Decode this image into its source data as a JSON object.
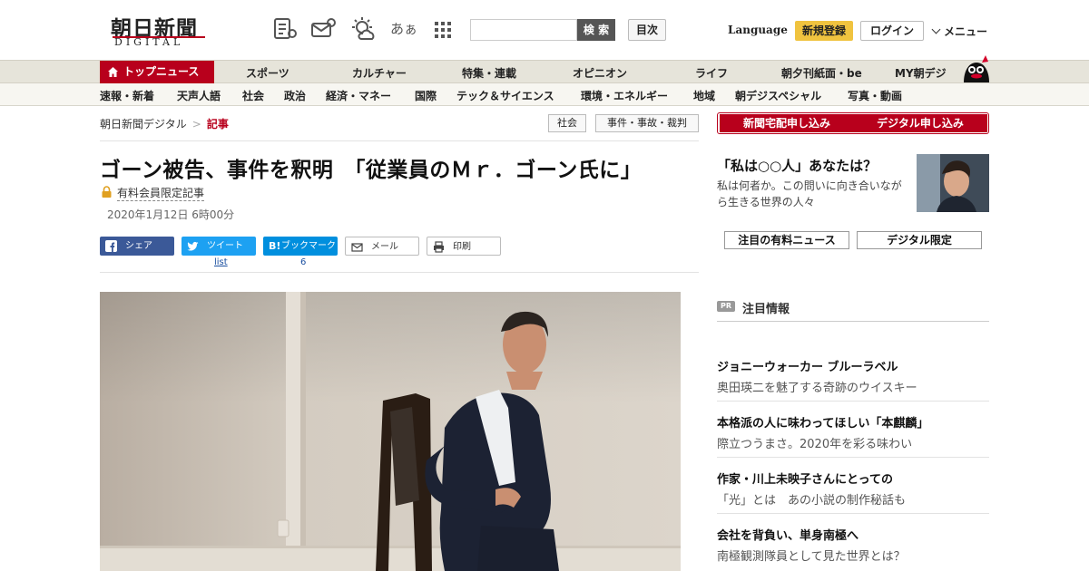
{
  "header": {
    "logo_main": "朝日新聞",
    "logo_sub": "DIGITAL",
    "icons": [
      "news-list-icon",
      "mail-icon",
      "weather-icon",
      "font-size-icon",
      "grid-menu-icon"
    ],
    "font_size_label": "あぁ",
    "search_placeholder": "",
    "search_button": "検 索",
    "toc_button": "目次",
    "language": "Language",
    "register": "新規登録",
    "login": "ログイン",
    "menu": "メニュー"
  },
  "nav_primary": [
    "トップニュース",
    "スポーツ",
    "カルチャー",
    "特集・連載",
    "オピニオン",
    "ライフ",
    "朝夕刊紙面・be",
    "MY朝デジ"
  ],
  "nav_secondary": [
    "速報・新着",
    "天声人語",
    "社会",
    "政治",
    "経済・マネー",
    "国際",
    "テック＆サイエンス",
    "環境・エネルギー",
    "地域",
    "朝デジスペシャル",
    "写真・動画"
  ],
  "breadcrumb": {
    "site": "朝日新聞デジタル",
    "sep": ">",
    "current": "記事"
  },
  "tags": [
    "社会",
    "事件・事故・裁判"
  ],
  "article": {
    "headline": "ゴーン被告、事件を釈明　「従業員のＭｒ．ゴーン氏に」",
    "paid_label": "有料会員限定記事",
    "date": "2020年1月12日 6時00分",
    "share": {
      "facebook": "シェア",
      "twitter": "ツイート",
      "twitter_count": "list",
      "hatena": "ブックマーク",
      "hatena_count": "6",
      "mail": "メール",
      "print": "印刷"
    }
  },
  "sidebar": {
    "subscribe_paper": "新聞宅配申し込み",
    "subscribe_digital": "デジタル申し込み",
    "promo_title": "「私は○○人」あなたは？",
    "promo_desc": "私は何者か。この問いに向き合いながら生きる世界の人々",
    "tabs": [
      "注目の有料ニュース",
      "デジタル限定"
    ],
    "pr_badge": "PR",
    "pr_heading": "注目情報",
    "ads": [
      {
        "title": "ジョニーウォーカー ブルーラベル",
        "desc": "奥田瑛二を魅了する奇跡のウイスキー"
      },
      {
        "title": "本格派の人に味わってほしい「本麒麟」",
        "desc": "際立つうまさ。2020年を彩る味わい"
      },
      {
        "title": "作家・川上未映子さんにとっての",
        "desc": "「光」とは　あの小説の制作秘話も"
      },
      {
        "title": "会社を背負い、単身南極へ",
        "desc": "南極観測隊員として見た世界とは？"
      }
    ]
  },
  "colors": {
    "brand_red": "#b8001c",
    "register_yellow": "#f0c33f",
    "nav_bg": "#e6e4da"
  }
}
